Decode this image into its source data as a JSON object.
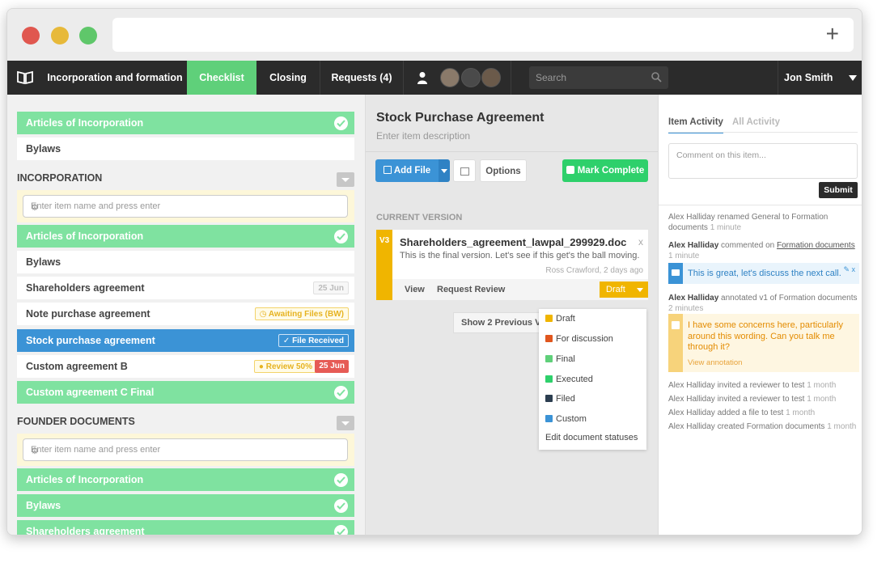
{
  "colors": {
    "accent_green": "#5fd07a",
    "row_green": "#7fe2a0",
    "blue": "#3b93d6",
    "draft_yellow": "#f0b500",
    "dark_nav": "#2b2b2b"
  },
  "browser": {
    "new_tab_symbol": "+"
  },
  "nav": {
    "logo_icon": "book-icon",
    "items": [
      {
        "label": "Incorporation and formation"
      },
      {
        "label": "Checklist"
      },
      {
        "label": "Closing"
      },
      {
        "label": "Requests (4)"
      }
    ],
    "search_placeholder": "Search",
    "user_name": "Jon Smith"
  },
  "checklist": {
    "top_rows": [
      {
        "label": "Articles of Incorporation"
      },
      {
        "label": "Bylaws"
      }
    ],
    "sections": [
      {
        "heading": "INCORPORATION",
        "input_placeholder": "Enter item name and press enter",
        "rows": [
          {
            "label": "Articles of Incorporation"
          },
          {
            "label": "Bylaws"
          },
          {
            "label": "Shareholders agreement",
            "badge": "25 Jun"
          },
          {
            "label": "Note purchase agreement",
            "badge": "Awaiting Files (BW)"
          },
          {
            "label": "Stock purchase agreement",
            "badge": "File Received"
          },
          {
            "label": "Custom agreement B",
            "badge": "Review 50%",
            "badge2": "25 Jun"
          },
          {
            "label": "Custom agreement C Final"
          }
        ]
      },
      {
        "heading": "FOUNDER DOCUMENTS",
        "input_placeholder": "Enter item name and press enter",
        "rows": [
          {
            "label": "Articles of Incorporation"
          },
          {
            "label": "Bylaws"
          },
          {
            "label": "Shareholders agreement"
          }
        ]
      }
    ]
  },
  "item": {
    "title": "Stock Purchase Agreement",
    "description_placeholder": "Enter item description",
    "add_file_label": "Add File",
    "options_label": "Options",
    "mark_complete_label": "Mark Complete",
    "current_version_label": "CURRENT VERSION",
    "document": {
      "version": "V3",
      "filename": "Shareholders_agreement_lawpal_299929.doc",
      "note": "This is the final version. Let's see if this get's the ball moving.",
      "meta": "Ross Crawford, 2 days ago",
      "close": "x",
      "view_label": "View",
      "request_review_label": "Request Review",
      "status": "Draft"
    },
    "show_previous_label": "Show 2 Previous Ve",
    "status_options": [
      {
        "label": "Draft",
        "color": "#f0b500"
      },
      {
        "label": "For discussion",
        "color": "#e0561e"
      },
      {
        "label": "Final",
        "color": "#5fd07a"
      },
      {
        "label": "Executed",
        "color": "#2ed06b"
      },
      {
        "label": "Filed",
        "color": "#2c3e50"
      },
      {
        "label": "Custom",
        "color": "#3b93d6"
      }
    ],
    "edit_statuses_label": "Edit document statuses"
  },
  "activity": {
    "tab_item": "Item Activity",
    "tab_all": "All Activity",
    "comment_placeholder": "Comment on this item...",
    "submit_label": "Submit",
    "entries": {
      "e1_text": "Alex Halliday renamed General to Formation documents",
      "e1_time": "1 minute",
      "e2_actor": "Alex Halliday",
      "e2_verb": "commented on",
      "e2_target": "Formation documents",
      "e2_time": "1 minute",
      "e2_comment": "This is great, let's discuss the next call.",
      "e2_comment_close": "x",
      "e3_actor": "Alex Halliday",
      "e3_text": "annotated v1 of Formation documents",
      "e3_time": "2 minutes",
      "e3_annotation": "I have some concerns here, particularly around this wording. Can you talk me through it?",
      "e3_link": "View annotation",
      "e4_text": "Alex Halliday invited a reviewer to test",
      "e4_time": "1 month",
      "e5_text": "Alex Halliday invited a reviewer to test",
      "e5_time": "1 month",
      "e6_text": "Alex Halliday added a file to test",
      "e6_time": "1 month",
      "e7_text": "Alex Halliday created Formation documents",
      "e7_time": "1 month"
    }
  }
}
